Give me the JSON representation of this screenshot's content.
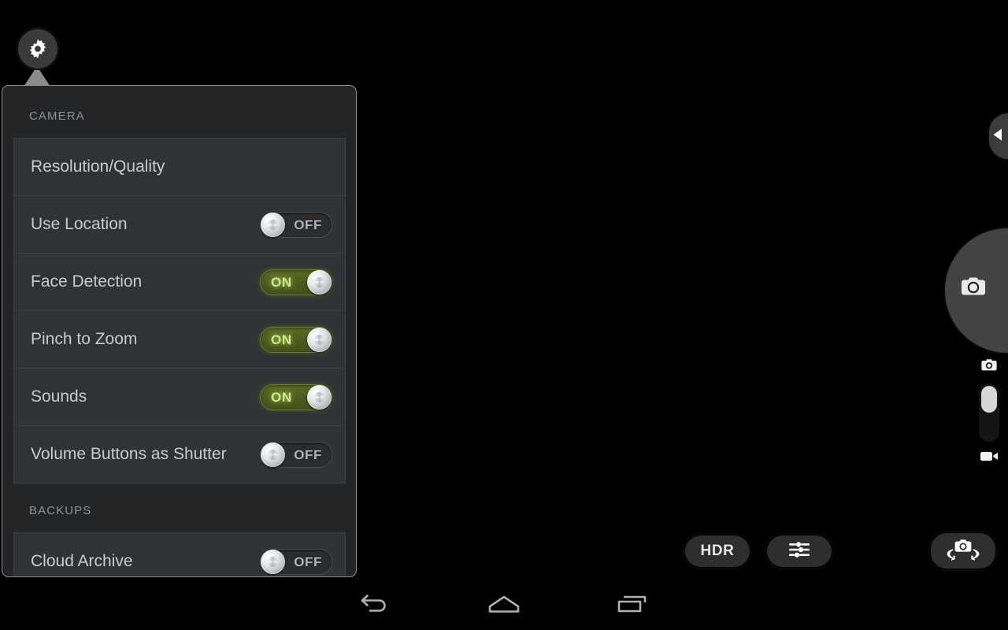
{
  "app": {
    "name": "Camera",
    "viewfinder_color": "#000000"
  },
  "settings_button": {
    "icon": "gear-icon",
    "label": "Settings"
  },
  "settings_panel": {
    "sections": [
      {
        "header": "CAMERA",
        "items": [
          {
            "label": "Resolution/Quality",
            "control": "none"
          },
          {
            "label": "Use Location",
            "control": "toggle",
            "state": "OFF"
          },
          {
            "label": "Face Detection",
            "control": "toggle",
            "state": "ON"
          },
          {
            "label": "Pinch to Zoom",
            "control": "toggle",
            "state": "ON"
          },
          {
            "label": "Sounds",
            "control": "toggle",
            "state": "ON"
          },
          {
            "label": "Volume Buttons as Shutter",
            "control": "toggle",
            "state": "OFF"
          }
        ]
      },
      {
        "header": "BACKUPS",
        "items": [
          {
            "label": "Cloud Archive",
            "control": "toggle",
            "state": "OFF"
          }
        ]
      }
    ]
  },
  "toolbar": {
    "hdr_label": "HDR",
    "sliders_icon": "sliders-icon",
    "switch_camera_icon": "switch-camera-icon"
  },
  "right_controls": {
    "expand_handle_icon": "chevron-left-icon",
    "shutter_icon": "camera-icon",
    "mode_top_icon": "camera-icon",
    "mode_bottom_icon": "video-camera-icon",
    "mode_selected": "camera"
  },
  "nav_bar": {
    "back_icon": "back-arrow-icon",
    "home_icon": "home-icon",
    "recents_icon": "recents-icon"
  },
  "colors": {
    "panel_bg": "#232527",
    "row_bg": "#303335",
    "toggle_on": "#4c5a1e",
    "toggle_on_text": "#cfe88c",
    "label_text": "#c8cacc",
    "header_text": "#8e9194"
  }
}
